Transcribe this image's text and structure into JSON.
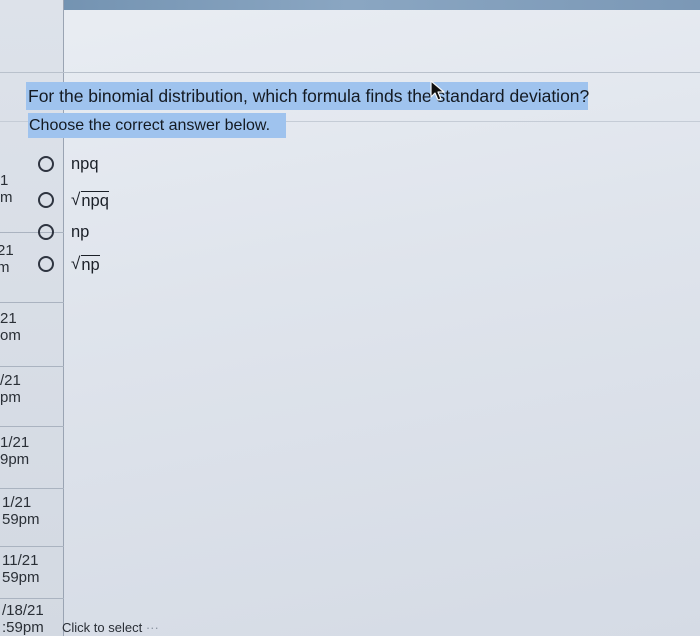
{
  "question": {
    "text": "For the binomial distribution, which formula finds the standard deviation?",
    "instruction": "Choose the correct answer below."
  },
  "choices": [
    {
      "label": "npq",
      "radical": false
    },
    {
      "label": "npq",
      "radical": true
    },
    {
      "label": "np",
      "radical": false
    },
    {
      "label": "np",
      "radical": true
    }
  ],
  "sidebar": {
    "entries": [
      {
        "date": "1",
        "time": "m"
      },
      {
        "date": "21",
        "time": "m"
      },
      {
        "date": "21",
        "time": "om"
      },
      {
        "date": "/21",
        "time": "pm"
      },
      {
        "date": "1/21",
        "time": "9pm"
      },
      {
        "date": "1/21",
        "time": "59pm"
      },
      {
        "date": "11/21",
        "time": "59pm"
      },
      {
        "date": "/18/21",
        "time": ":59pm"
      }
    ]
  },
  "footer": {
    "text": "Click to select"
  },
  "icons": {
    "cursor": "mouse-pointer-icon",
    "radio": "radio-button-icon"
  },
  "colors": {
    "highlight": "#9fc3ee",
    "background": "#e3e8ef"
  }
}
